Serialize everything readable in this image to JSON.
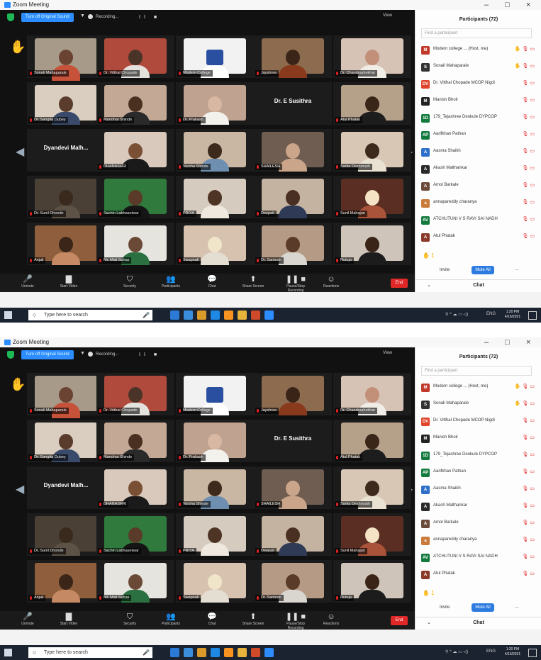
{
  "window": {
    "title": "Zoom Meeting",
    "minimize": "–",
    "maximize": "□",
    "close": "×"
  },
  "topbar": {
    "gallery_label": "Turn off Original Sound",
    "recording_label": "Recording...",
    "pause_label": "II ■",
    "view_label": "View"
  },
  "gallery": {
    "navigation": {
      "left": "◀",
      "right": "▶"
    },
    "tiles": [
      {
        "name": "Sonali Mahaparale",
        "hand": true,
        "bg": "#a79a88",
        "shirt": "#c6523a",
        "head": "#6b4332"
      },
      {
        "name": "Dr. Vitthal Chopade",
        "bg": "#b04a3d",
        "shirt": "#e4e2dc",
        "head": "#4a3428"
      },
      {
        "name": "Modern College",
        "logo": true,
        "bg": "#f2f2f2",
        "shirt": "#ffffff",
        "head": "#2a4fa0"
      },
      {
        "name": "Jayshree",
        "bg": "#8c6b4f",
        "shirt": "#8a3a1c",
        "head": "#3a2418"
      },
      {
        "name": "Dr. Chandrashekhar",
        "bg": "#d7c3b6",
        "shirt": "#f0ece6",
        "head": "#c28f78"
      },
      {
        "name": "Dr. Sangita Dubey",
        "bg": "#d9cebf",
        "shirt": "#3a4a6a",
        "head": "#5a3c2c"
      },
      {
        "name": "Manohar Shinde",
        "bg": "#c4a896",
        "shirt": "#2a2a2a",
        "head": "#4a3020"
      },
      {
        "name": "Dr. Prakash",
        "bg": "#bfa290",
        "shirt": "#f3f1ec",
        "head": "#d9b8a3"
      },
      {
        "name": "Dr. E Susithra",
        "textOnly": true,
        "bg": "#1b1b1b"
      },
      {
        "name": "Atul Phatak",
        "bg": "#b5a08a",
        "shirt": "#1d1d1d",
        "head": "#3a2618"
      },
      {
        "name": "Dyandevi Malh...",
        "textOnly": true,
        "bg": "#1b1b1b"
      },
      {
        "name": "DHANASHRI",
        "bg": "#d8c9bc",
        "shirt": "#1a1a1a",
        "head": "#7a5034"
      },
      {
        "name": "Varsha Shinde",
        "bg": "#c9b7a3",
        "shirt": "#6f8fb0",
        "head": "#3e2a1d"
      },
      {
        "name": "SHAILESH",
        "bg": "#6e5d50",
        "shirt": "#caa58a",
        "head": "#caa58a"
      },
      {
        "name": "Sarita Deshmukh",
        "bg": "#d8c7b5",
        "shirt": "#e9e2d2",
        "head": "#3e2a1d"
      },
      {
        "name": "Dr. Sunil Dhonde",
        "bg": "#4a4036",
        "shirt": "#5c5246",
        "head": "#3a2a1e"
      },
      {
        "name": "Sachin Labhasetwar",
        "bg": "#2f7a3c",
        "shirt": "#151515",
        "head": "#5a3a28"
      },
      {
        "name": "PRIYA",
        "bg": "#d5cbbf",
        "shirt": "#eee8de",
        "head": "#4e3424"
      },
      {
        "name": "Deepali",
        "bg": "#c5b3a1",
        "shirt": "#2e3a56",
        "head": "#4a3022"
      },
      {
        "name": "Sunil Mahajan",
        "bg": "#5a2e22",
        "shirt": "#a8533a",
        "head": "#f4e3c4"
      },
      {
        "name": "Anjali",
        "bg": "#8f5f3d",
        "shirt": "#c58a63",
        "head": "#3a2518"
      },
      {
        "name": "Mr. Mali Suhas",
        "bg": "#e6e4df",
        "shirt": "#2a7040",
        "head": "#6a4a36"
      },
      {
        "name": "Swapnali",
        "bg": "#d7c2b0",
        "shirt": "#e3ddd2",
        "head": "#f1e5c9"
      },
      {
        "name": "Dr. Santosh",
        "bg": "#b59a86",
        "shirt": "#d9d6cf",
        "head": "#5a3a28"
      },
      {
        "name": "Rutuja",
        "bg": "#cfc4b9",
        "shirt": "#1c1c1c",
        "head": "#3a2418"
      }
    ]
  },
  "toolbar": {
    "items": [
      {
        "label": "Unmute",
        "icon": "🎤"
      },
      {
        "label": "Start Video",
        "icon": "▇"
      },
      {
        "label": "Security",
        "icon": "⛉"
      },
      {
        "label": "Participants",
        "icon": "👥"
      },
      {
        "label": "Chat",
        "icon": "💬"
      },
      {
        "label": "Share Screen",
        "icon": "⬆"
      },
      {
        "label": "Pause/Stop Recording",
        "icon": "❚❚ ■"
      },
      {
        "label": "Reactions",
        "icon": "☺"
      }
    ],
    "end_label": "End"
  },
  "panel": {
    "title": "Participants (72)",
    "search_placeholder": "Find a participant",
    "participants": [
      {
        "name": "Modern college ... (Host, me)",
        "initials": "M",
        "color": "#c0392b",
        "icons": "✋ 🎙 ▭"
      },
      {
        "name": "Sonali Mahaparale",
        "initials": "S",
        "color": "#333333",
        "icons": "✋ 🎙 ▭"
      },
      {
        "name": "Dr. Vitthal Chopade MCOP Nigdi",
        "initials": "DV",
        "color": "#e0442a",
        "icons": "🎙 ▭"
      },
      {
        "name": "Manish Bhoir",
        "initials": "M",
        "color": "#222222",
        "icons": "🎙 ▭"
      },
      {
        "name": "179_Tejashree Deokule DYPCOP",
        "initials": "1D",
        "color": "#137a3e",
        "icons": "🎙 ▭"
      },
      {
        "name": "Aarifkhan Pathan",
        "initials": "AP",
        "color": "#137a3e",
        "icons": "🎙 ▭"
      },
      {
        "name": "Aasma Shaikh",
        "initials": "A",
        "color": "#2d6fc9",
        "icons": "🎙 ▭"
      },
      {
        "name": "Akash Malthankar",
        "initials": "A",
        "color": "#2a2a2a",
        "icons": "🎙 ▭"
      },
      {
        "name": "Amol Barkale",
        "initials": "A",
        "color": "#6b4a3a",
        "icons": "🎙 ▭"
      },
      {
        "name": "annapareddy charanya",
        "initials": "a",
        "color": "#c97a3a",
        "icons": "🎙 ▭"
      },
      {
        "name": "ATCHUTUNI V S RAVI SAI NADH",
        "initials": "AV",
        "color": "#137a3e",
        "icons": "🎙 ▭"
      },
      {
        "name": "Atul Phatak",
        "initials": "A",
        "color": "#8a3a2a",
        "icons": "🎙 ▭"
      }
    ],
    "hand_count": "✋ 1",
    "invite_label": "Invite",
    "mute_all_label": "Mute All",
    "more_label": "...",
    "chat_label": "Chat"
  },
  "taskbar": {
    "search_placeholder": "Type here to search",
    "time": "1:20 PM",
    "date": "4/16/2021",
    "lang": "ENG",
    "apps": [
      "#2b7bd6",
      "#3a8edb",
      "#d99a2a",
      "#1e88e5",
      "#f7931e",
      "#e8b33a",
      "#d04a2a",
      "#2d8cff"
    ]
  }
}
